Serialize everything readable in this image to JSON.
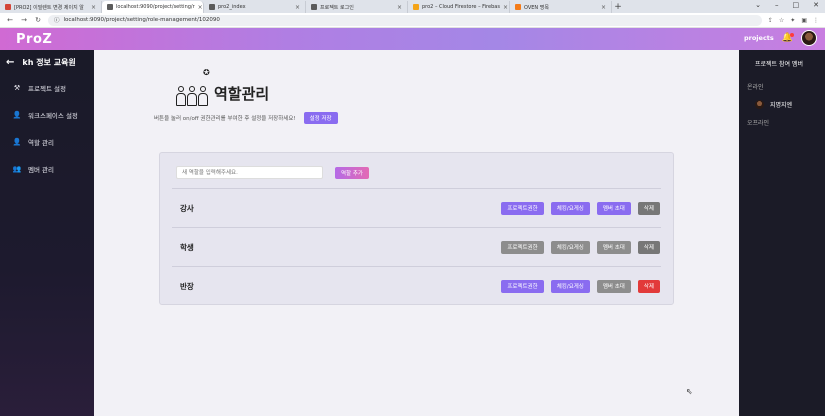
{
  "browser": {
    "tabs": [
      {
        "label": "[PRO2] 이빌렌트 변경 제이지 알",
        "color": "#d44638",
        "active": false
      },
      {
        "label": "localhost:9090/project/setting/r",
        "color": "#5b5b5b",
        "active": true
      },
      {
        "label": "pro2_index",
        "color": "#5b5b5b",
        "active": false
      },
      {
        "label": "프로젝트 로그인",
        "color": "#5b5b5b",
        "active": false
      },
      {
        "label": "pro2 – Cloud Firestore – Firebas",
        "color": "#f4a418",
        "active": false
      },
      {
        "label": "OVEN 명목",
        "color": "#f47b18",
        "active": false
      }
    ],
    "new_tab": "+",
    "url": "localhost:9090/project/setting/role-management/102090",
    "win_min": "⌄",
    "win_minimize": "–",
    "win_max": "□",
    "win_close": "✕"
  },
  "header": {
    "logo": "ProZ",
    "projects_link": "projects"
  },
  "sidebar": {
    "title": "kh 정보 교육원",
    "items": [
      {
        "label": "프로젝트 설정",
        "icon": "⚒"
      },
      {
        "label": "워크스페이스 설정",
        "icon": "👤"
      },
      {
        "label": "역할 관리",
        "icon": "👤"
      },
      {
        "label": "멤버 관리",
        "icon": "👥"
      }
    ]
  },
  "main": {
    "title": "역할관리",
    "hint": "버튼을 눌러 on/off 권한관리를 부여한 후 설정을 저장하세요!",
    "save_button": "설정 저장",
    "role_input_placeholder": "새 역할을 입력해주세요.",
    "add_role_button": "역할 추가",
    "roles": [
      {
        "name": "강사",
        "perm_project": "프로젝트권한",
        "perm_request": "체킹/요게싱",
        "perm_invite": "멤버 초대",
        "delete": "삭제"
      },
      {
        "name": "학생",
        "perm_project": "프로젝트권한",
        "perm_request": "체킹/요게싱",
        "perm_invite": "멤버 초대",
        "delete": "삭제"
      },
      {
        "name": "반장",
        "perm_project": "프로젝트권한",
        "perm_request": "체킹/요게싱",
        "perm_invite": "멤버 초대",
        "delete": "삭제"
      }
    ]
  },
  "right_panel": {
    "title": "프로젝트 참여 멤버",
    "online_label": "온라인",
    "online_user": "지명지엔",
    "offline_label": "오프라인"
  }
}
